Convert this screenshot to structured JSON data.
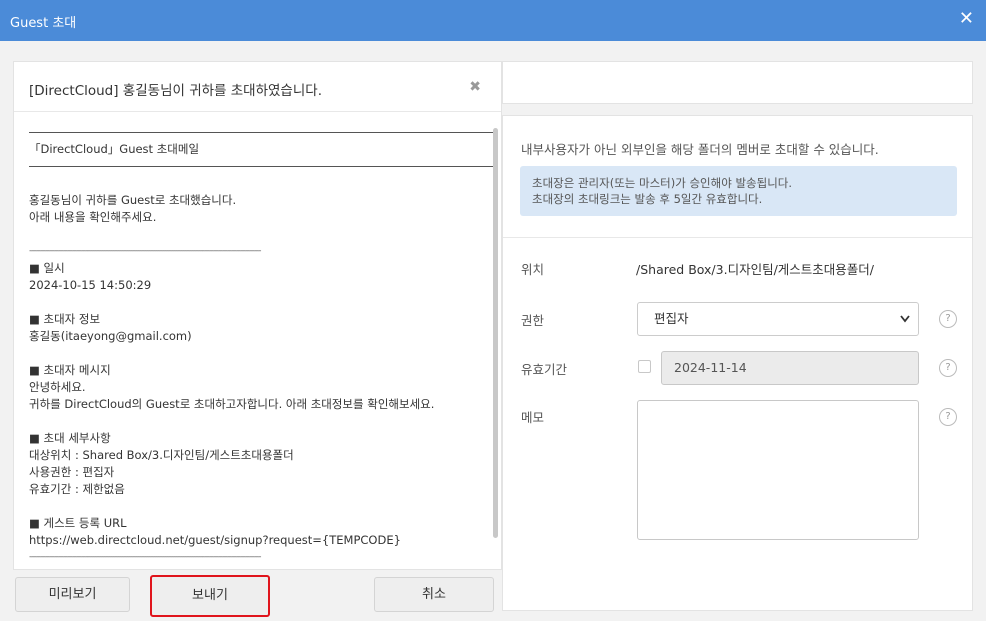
{
  "window": {
    "title": "Guest 초대",
    "close_glyph": "✕"
  },
  "mail": {
    "subject": "[DirectCloud] 홍길동님이 귀하를 초대하였습니다.",
    "close_glyph": "✖",
    "heading": "「DirectCloud」Guest 초대메일",
    "greeting_1": "홍길동님이 귀하를 Guest로 초대했습니다.",
    "greeting_2": "아래 내용을 확인해주세요.",
    "dash_line": "-------------------------------------------------------------------------------------------------------",
    "section_datetime_title": "■ 일시",
    "section_datetime_value": "2024-10-15 14:50:29",
    "section_inviter_title": "■ 초대자 정보",
    "section_inviter_value": "홍길동(itaeyong@gmail.com)",
    "section_message_title": "■ 초대자 메시지",
    "section_message_line1": "안녕하세요.",
    "section_message_line2": "귀하를 DirectCloud의 Guest로 초대하고자합니다. 아래 초대정보를 확인해보세요.",
    "section_details_title": "■ 초대 세부사항",
    "section_details_location": "대상위치 : Shared Box/3.디자인팀/게스트초대용폴더",
    "section_details_role": "사용권한 : 편집자",
    "section_details_expiry": "유효기간 : 제한없음",
    "section_url_title": "■ 게스트 등록 URL",
    "section_url_value": "https://web.directcloud.net/guest/signup?request={TEMPCODE}"
  },
  "buttons": {
    "preview": "미리보기",
    "send": "보내기",
    "cancel": "취소"
  },
  "form": {
    "description": "내부사용자가 아닌 외부인을 해당 폴더의 멤버로 초대할 수 있습니다.",
    "notice_line1": "초대장은 관리자(또는 마스터)가 승인해야 발송됩니다.",
    "notice_line2": "초대장의 초대링크는 발송 후 5일간 유효합니다.",
    "location_label": "위치",
    "location_value": "/Shared Box/3.디자인팀/게스트초대용폴더/",
    "permission_label": "권한",
    "permission_value": "편집자",
    "expiry_label": "유효기간",
    "expiry_value": "2024-11-14",
    "expiry_checked": false,
    "memo_label": "메모",
    "memo_value": "",
    "help_glyph": "?"
  },
  "colors": {
    "titlebar": "#4b8bd8",
    "notice_bg": "#d9e7f6",
    "send_highlight": "#e0141c"
  }
}
